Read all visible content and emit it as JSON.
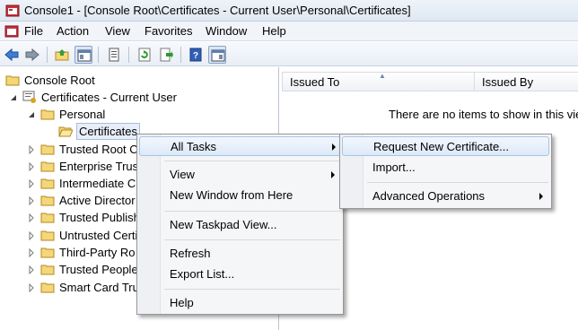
{
  "window": {
    "title": "Console1 - [Console Root\\Certificates - Current User\\Personal\\Certificates]"
  },
  "menubar": {
    "items": [
      "File",
      "Action",
      "View",
      "Favorites",
      "Window",
      "Help"
    ]
  },
  "toolbar": {
    "buttons": [
      "back-icon",
      "forward-icon",
      "up-folder-icon",
      "show-hide-tree-icon",
      "properties-icon",
      "refresh-icon",
      "export-list-icon",
      "help-icon",
      "show-hide-action-pane-icon"
    ],
    "pressed": [
      "show-hide-tree-icon",
      "show-hide-action-pane-icon"
    ]
  },
  "tree": {
    "items": [
      {
        "label": "Console Root"
      },
      {
        "label": "Certificates - Current User"
      },
      {
        "label": "Personal"
      },
      {
        "label": "Certificates",
        "selected": true
      },
      {
        "label": "Trusted Root C"
      },
      {
        "label": "Enterprise Trus"
      },
      {
        "label": "Intermediate C"
      },
      {
        "label": "Active Director"
      },
      {
        "label": "Trusted Publish"
      },
      {
        "label": "Untrusted Certif"
      },
      {
        "label": "Third-Party Ro"
      },
      {
        "label": "Trusted People"
      },
      {
        "label": "Smart Card Tru"
      }
    ]
  },
  "list": {
    "columns": [
      "Issued To",
      "Issued By"
    ],
    "sorted_column": "Issued To",
    "empty_message": "There are no items to show in this vie"
  },
  "context_menu": {
    "items": [
      "All Tasks",
      "View",
      "New Window from Here",
      "New Taskpad View...",
      "Refresh",
      "Export List...",
      "Help"
    ],
    "highlighted": "All Tasks"
  },
  "all_tasks_submenu": {
    "items": [
      "Request New Certificate...",
      "Import...",
      "Advanced Operations"
    ],
    "highlighted": "Request New Certificate..."
  },
  "colors": {
    "highlight_border": "#a8c4e8",
    "folder_yellow": "#f5d77a",
    "menu_background": "#f5f6f8"
  }
}
